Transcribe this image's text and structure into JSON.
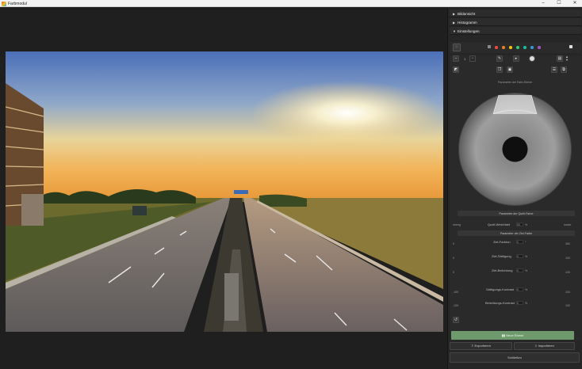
{
  "window": {
    "title": "Farbmodul",
    "minimize": "–",
    "maximize": "☐",
    "close": "✕"
  },
  "sections": {
    "bildansicht": "Bildansicht",
    "histogramm": "Histogramm",
    "einstellungen": "Einstellungen"
  },
  "colors": {
    "accent_green": "#6e9a6e",
    "swatches": [
      "#e74c3c",
      "#e67e22",
      "#f1c40f",
      "#2ecc71",
      "#1abc9c",
      "#3498db",
      "#9b59b6"
    ]
  },
  "toolbar": {
    "count_label": "1"
  },
  "wheel_title": "Parameter der Farb-Ebene",
  "source_section": {
    "header": "Parameter der Quell-Farbe",
    "left_label": "streng",
    "right_label": "locker",
    "field_label": "Quell-Weichheit",
    "value": "50",
    "unit": "%"
  },
  "target_section": {
    "header": "Parameter der Ziel-Farbe",
    "rows": [
      {
        "label": "Ziel-Farbton",
        "left": "0",
        "value": "0",
        "unit": "°",
        "right": "360"
      },
      {
        "label": "Ziel-Sättigung",
        "left": "0",
        "value": "0",
        "unit": "%",
        "right": "100"
      },
      {
        "label": "Ziel-Belichtung",
        "left": "0",
        "value": "0",
        "unit": "%",
        "right": "100"
      },
      {
        "label": "Sättigungs-Kontrast",
        "left": "-100",
        "value": "0",
        "unit": "%",
        "right": "100"
      },
      {
        "label": "Belichtungs-Kontrast",
        "left": "-100",
        "value": "0",
        "unit": "%",
        "right": "100"
      }
    ]
  },
  "buttons": {
    "new_layer": "Neue Ebene",
    "export": "Exportieren",
    "import": "Importieren",
    "close": "Schließen"
  }
}
